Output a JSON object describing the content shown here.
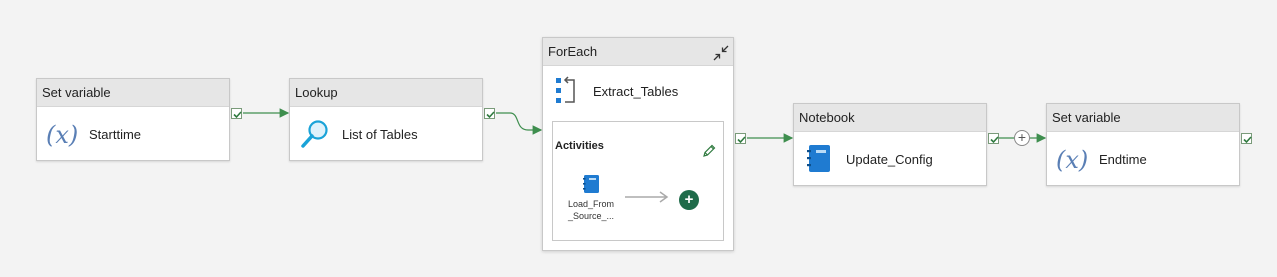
{
  "activities": [
    {
      "type": "Set variable",
      "name": "Starttime",
      "icon": "variable-icon"
    },
    {
      "type": "Lookup",
      "name": "List of Tables",
      "icon": "lookup-icon"
    },
    {
      "type": "Notebook",
      "name": "Update_Config",
      "icon": "notebook-icon"
    },
    {
      "type": "Set variable",
      "name": "Endtime",
      "icon": "variable-icon"
    }
  ],
  "foreach": {
    "type": "ForEach",
    "name": "Extract_Tables",
    "activities_label": "Activities",
    "inner_activity": {
      "name": "Load_From_Source_...",
      "line1": "Load_From",
      "line2": "_Source_..."
    },
    "add_symbol": "+"
  },
  "colors": {
    "success_line": "#3e8e4e",
    "header_bg": "#e6e6e6",
    "canvas_bg": "#f3f3f3",
    "add_button": "#1f6b4a",
    "notebook_blue": "#1f7bd1",
    "variable_blue": "#5a7fb5"
  },
  "connector_plus": "+"
}
